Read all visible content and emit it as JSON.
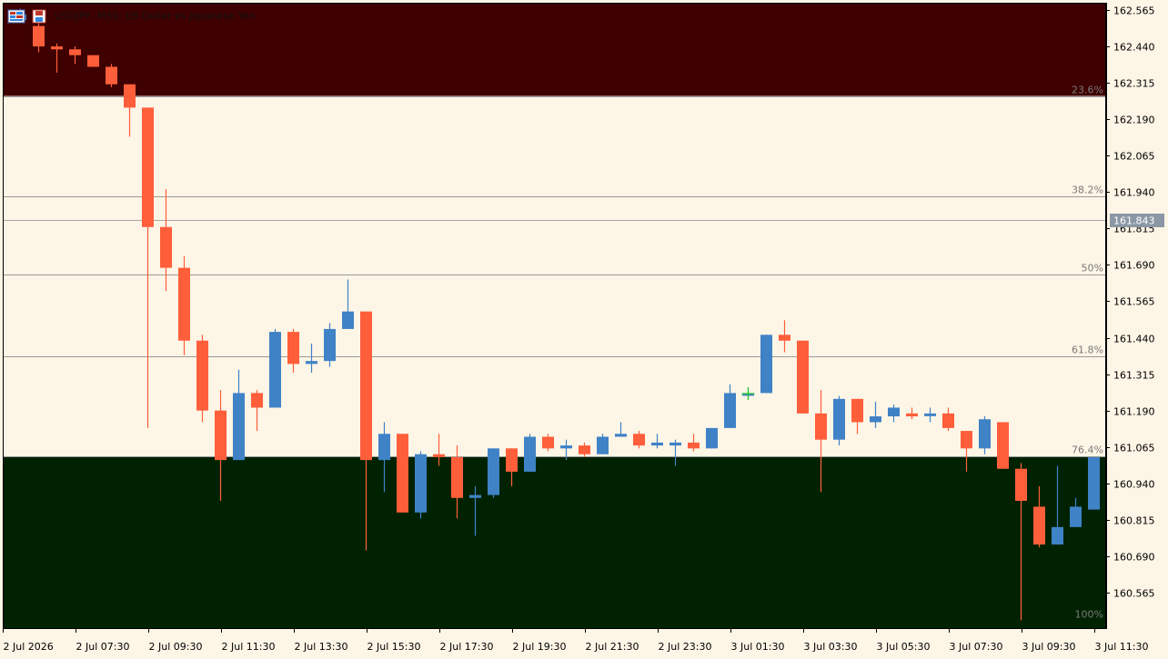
{
  "window": {
    "title": "USDJPY, M30:  US Dollar vs Japanese Yen",
    "icons": [
      "chart-window-icon",
      "save-icon"
    ]
  },
  "colors": {
    "background": "#FDF5E6",
    "upper_zone": "#3E0000",
    "lower_zone": "#002200",
    "bear_candle": "#FF5E3A",
    "bull_candle": "#3F82C6",
    "fib_line": "#9A9A9A",
    "current_price_badge": "#8B97A5",
    "axis_line": "#000000"
  },
  "chart_data": {
    "type": "candlestick",
    "symbol": "USDJPY",
    "timeframe": "M30",
    "description": "US Dollar vs Japanese Yen",
    "current_price": "161.843",
    "ylim": [
      160.44,
      162.59
    ],
    "price_ticks": [
      "162.565",
      "162.440",
      "162.315",
      "162.190",
      "162.065",
      "161.940",
      "161.815",
      "161.690",
      "161.565",
      "161.440",
      "161.315",
      "161.190",
      "161.065",
      "160.940",
      "160.815",
      "160.690",
      "160.565"
    ],
    "time_ticks": [
      "2 Jul 2026",
      "2 Jul 07:30",
      "2 Jul 09:30",
      "2 Jul 11:30",
      "2 Jul 13:30",
      "2 Jul 15:30",
      "2 Jul 17:30",
      "2 Jul 19:30",
      "2 Jul 21:30",
      "2 Jul 23:30",
      "3 Jul 01:30",
      "3 Jul 03:30",
      "3 Jul 05:30",
      "3 Jul 07:30",
      "3 Jul 09:30",
      "3 Jul 11:30"
    ],
    "fibonacci": {
      "high": 162.565,
      "low": 160.468,
      "levels": [
        {
          "label": "23.6%",
          "price": 162.27
        },
        {
          "label": "38.2%",
          "price": 161.925
        },
        {
          "label": "50%",
          "price": 161.656
        },
        {
          "label": "61.8%",
          "price": 161.375
        },
        {
          "label": "76.4%",
          "price": 161.032
        },
        {
          "label": "100%",
          "price": 160.468
        }
      ]
    },
    "candles": [
      {
        "o": 162.53,
        "h": 162.57,
        "l": 162.55,
        "c": 162.55
      },
      {
        "o": 162.51,
        "h": 162.56,
        "l": 162.42,
        "c": 162.44
      },
      {
        "o": 162.44,
        "h": 162.45,
        "l": 162.35,
        "c": 162.43
      },
      {
        "o": 162.43,
        "h": 162.44,
        "l": 162.38,
        "c": 162.41
      },
      {
        "o": 162.41,
        "h": 162.41,
        "l": 162.37,
        "c": 162.37
      },
      {
        "o": 162.37,
        "h": 162.38,
        "l": 162.3,
        "c": 162.31
      },
      {
        "o": 162.31,
        "h": 162.31,
        "l": 162.13,
        "c": 162.23
      },
      {
        "o": 162.23,
        "h": 162.23,
        "l": 161.13,
        "c": 161.82
      },
      {
        "o": 161.82,
        "h": 161.95,
        "l": 161.6,
        "c": 161.68
      },
      {
        "o": 161.68,
        "h": 161.72,
        "l": 161.38,
        "c": 161.43
      },
      {
        "o": 161.43,
        "h": 161.45,
        "l": 161.15,
        "c": 161.19
      },
      {
        "o": 161.19,
        "h": 161.26,
        "l": 160.88,
        "c": 161.02
      },
      {
        "o": 161.02,
        "h": 161.33,
        "l": 161.02,
        "c": 161.25
      },
      {
        "o": 161.25,
        "h": 161.26,
        "l": 161.12,
        "c": 161.2
      },
      {
        "o": 161.2,
        "h": 161.47,
        "l": 161.2,
        "c": 161.46
      },
      {
        "o": 161.46,
        "h": 161.47,
        "l": 161.32,
        "c": 161.35
      },
      {
        "o": 161.35,
        "h": 161.42,
        "l": 161.32,
        "c": 161.36
      },
      {
        "o": 161.36,
        "h": 161.49,
        "l": 161.34,
        "c": 161.47
      },
      {
        "o": 161.47,
        "h": 161.64,
        "l": 161.47,
        "c": 161.53
      },
      {
        "o": 161.53,
        "h": 161.53,
        "l": 160.71,
        "c": 161.02
      },
      {
        "o": 161.02,
        "h": 161.15,
        "l": 160.91,
        "c": 161.11
      },
      {
        "o": 161.11,
        "h": 161.11,
        "l": 160.84,
        "c": 160.84
      },
      {
        "o": 160.84,
        "h": 161.05,
        "l": 160.82,
        "c": 161.04
      },
      {
        "o": 161.04,
        "h": 161.11,
        "l": 161.0,
        "c": 161.03
      },
      {
        "o": 161.03,
        "h": 161.07,
        "l": 160.82,
        "c": 160.89
      },
      {
        "o": 160.89,
        "h": 160.93,
        "l": 160.76,
        "c": 160.9
      },
      {
        "o": 160.9,
        "h": 161.06,
        "l": 160.89,
        "c": 161.06
      },
      {
        "o": 161.06,
        "h": 161.06,
        "l": 160.93,
        "c": 160.98
      },
      {
        "o": 160.98,
        "h": 161.11,
        "l": 160.98,
        "c": 161.1
      },
      {
        "o": 161.1,
        "h": 161.11,
        "l": 161.05,
        "c": 161.06
      },
      {
        "o": 161.06,
        "h": 161.09,
        "l": 161.02,
        "c": 161.07
      },
      {
        "o": 161.07,
        "h": 161.08,
        "l": 161.03,
        "c": 161.04
      },
      {
        "o": 161.04,
        "h": 161.11,
        "l": 161.04,
        "c": 161.1
      },
      {
        "o": 161.1,
        "h": 161.15,
        "l": 161.1,
        "c": 161.11
      },
      {
        "o": 161.11,
        "h": 161.12,
        "l": 161.06,
        "c": 161.07
      },
      {
        "o": 161.07,
        "h": 161.11,
        "l": 161.06,
        "c": 161.08
      },
      {
        "o": 161.07,
        "h": 161.09,
        "l": 161.0,
        "c": 161.08
      },
      {
        "o": 161.08,
        "h": 161.11,
        "l": 161.05,
        "c": 161.06
      },
      {
        "o": 161.06,
        "h": 161.13,
        "l": 161.06,
        "c": 161.13
      },
      {
        "o": 161.13,
        "h": 161.28,
        "l": 161.13,
        "c": 161.25
      },
      {
        "o": 161.25,
        "h": 161.27,
        "l": 161.23,
        "c": 161.25
      },
      {
        "o": 161.25,
        "h": 161.45,
        "l": 161.25,
        "c": 161.45
      },
      {
        "o": 161.45,
        "h": 161.5,
        "l": 161.39,
        "c": 161.43
      },
      {
        "o": 161.43,
        "h": 161.43,
        "l": 161.18,
        "c": 161.18
      },
      {
        "o": 161.18,
        "h": 161.26,
        "l": 160.91,
        "c": 161.09
      },
      {
        "o": 161.09,
        "h": 161.24,
        "l": 161.07,
        "c": 161.23
      },
      {
        "o": 161.23,
        "h": 161.23,
        "l": 161.11,
        "c": 161.15
      },
      {
        "o": 161.15,
        "h": 161.22,
        "l": 161.13,
        "c": 161.17
      },
      {
        "o": 161.17,
        "h": 161.21,
        "l": 161.15,
        "c": 161.2
      },
      {
        "o": 161.18,
        "h": 161.2,
        "l": 161.16,
        "c": 161.17
      },
      {
        "o": 161.18,
        "h": 161.2,
        "l": 161.15,
        "c": 161.18
      },
      {
        "o": 161.18,
        "h": 161.2,
        "l": 161.12,
        "c": 161.13
      },
      {
        "o": 161.12,
        "h": 161.12,
        "l": 160.98,
        "c": 161.06
      },
      {
        "o": 161.06,
        "h": 161.17,
        "l": 161.04,
        "c": 161.16
      },
      {
        "o": 161.15,
        "h": 161.15,
        "l": 160.99,
        "c": 160.99
      },
      {
        "o": 160.99,
        "h": 161.01,
        "l": 160.47,
        "c": 160.88
      },
      {
        "o": 160.86,
        "h": 160.93,
        "l": 160.72,
        "c": 160.73
      },
      {
        "o": 160.73,
        "h": 161.0,
        "l": 160.73,
        "c": 160.79
      },
      {
        "o": 160.79,
        "h": 160.89,
        "l": 160.79,
        "c": 160.86
      },
      {
        "o": 160.85,
        "h": 161.03,
        "l": 160.85,
        "c": 161.03
      }
    ],
    "candle_count": 60
  }
}
